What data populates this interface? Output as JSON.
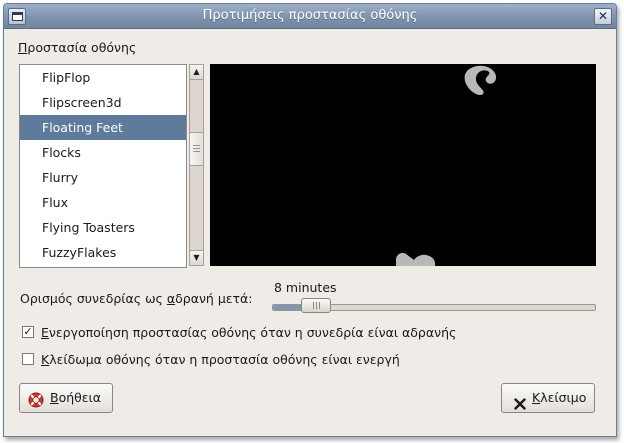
{
  "window": {
    "title": "Προτιμήσεις προστασίας οθόνης",
    "close_glyph": "✕"
  },
  "screensaver_section": {
    "label": "Προστασία οθόνης",
    "items": [
      {
        "label": "FlipFlop",
        "selected": false
      },
      {
        "label": "Flipscreen3d",
        "selected": false
      },
      {
        "label": "Floating Feet",
        "selected": true
      },
      {
        "label": "Flocks",
        "selected": false
      },
      {
        "label": "Flurry",
        "selected": false
      },
      {
        "label": "Flux",
        "selected": false
      },
      {
        "label": "Flying Toasters",
        "selected": false
      },
      {
        "label": "FuzzyFlakes",
        "selected": false
      }
    ],
    "scroll_fraction": 0.38
  },
  "idle": {
    "label_before": "Ορισμός συνεδρίας ως ",
    "label_mnemonic": "α",
    "label_after": "δρανή μετά:",
    "value": "8 minutes",
    "slider_fraction": 0.1
  },
  "options": {
    "activate": {
      "checked": true,
      "label_before": "",
      "label_mnemonic": "Ε",
      "label_after": "νεργοποίηση προστασίας οθόνης όταν η συνεδρία είναι αδρανής"
    },
    "lock": {
      "checked": false,
      "label_before": "",
      "label_mnemonic": "Κ",
      "label_after": "λείδωμα οθόνης όταν η προστασία οθόνης είναι ενεργή"
    }
  },
  "buttons": {
    "help": {
      "mnemonic": "Β",
      "rest": "οήθεια",
      "icon": "help-lifebuoy-icon"
    },
    "close": {
      "mnemonic": "Κ",
      "rest": "λείσιμο",
      "icon": "close-x-icon"
    }
  },
  "colors": {
    "selection": "#5f7b9c",
    "titlebar": "#7e93ae",
    "preview_background": "#000000",
    "preview_shape": "#b8b8b8"
  },
  "icons": {
    "check_glyph": "✓",
    "scroll_up_glyph": "▲",
    "scroll_down_glyph": "▼"
  }
}
